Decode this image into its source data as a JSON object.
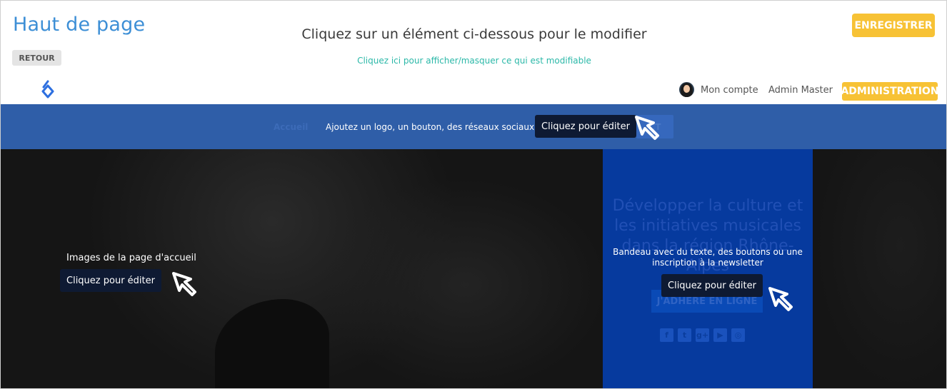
{
  "editor": {
    "title": "Haut de page",
    "back_label": "RETOUR",
    "instruction": "Cliquez sur un élément ci-dessous pour le modifier",
    "toggle_link": "Cliquez ici pour afficher/masquer ce qui est modifiable",
    "save_label": "ENREGISTRER"
  },
  "topbar": {
    "account_label": "Mon compte",
    "admin_name": "Admin Master",
    "admin_button": "ADMINISTRATION"
  },
  "nav": {
    "home_label": "Accueil",
    "hint": "Ajoutez un logo, un bouton, des réseaux sociaux",
    "ghost_button": "CT",
    "edit_label": "Cliquez pour éditer"
  },
  "hero": {
    "caption": "Images de la page d'accueil",
    "edit_label": "Cliquez pour éditer"
  },
  "banner": {
    "heading": "Développer la culture et les initiatives musicales dans la région Rhône-Alpes",
    "hint": "Bandeau avec du texte, des boutons ou une inscription à la newsletter",
    "edit_label": "Cliquez pour éditer",
    "join_button": "J'ADHÈRE EN LIGNE",
    "socials": [
      {
        "icon": "facebook-icon",
        "glyph": "f"
      },
      {
        "icon": "twitter-icon",
        "glyph": "t"
      },
      {
        "icon": "google-plus-icon",
        "glyph": "g+"
      },
      {
        "icon": "youtube-icon",
        "glyph": "▶"
      },
      {
        "icon": "instagram-icon",
        "glyph": "◎"
      }
    ]
  },
  "colors": {
    "accent_blue": "#3d8fd6",
    "accent_yellow": "#f7c235",
    "link_teal": "#2bb8a8",
    "nav_blue": "#2f5ea8",
    "banner_blue": "#063a9e"
  }
}
